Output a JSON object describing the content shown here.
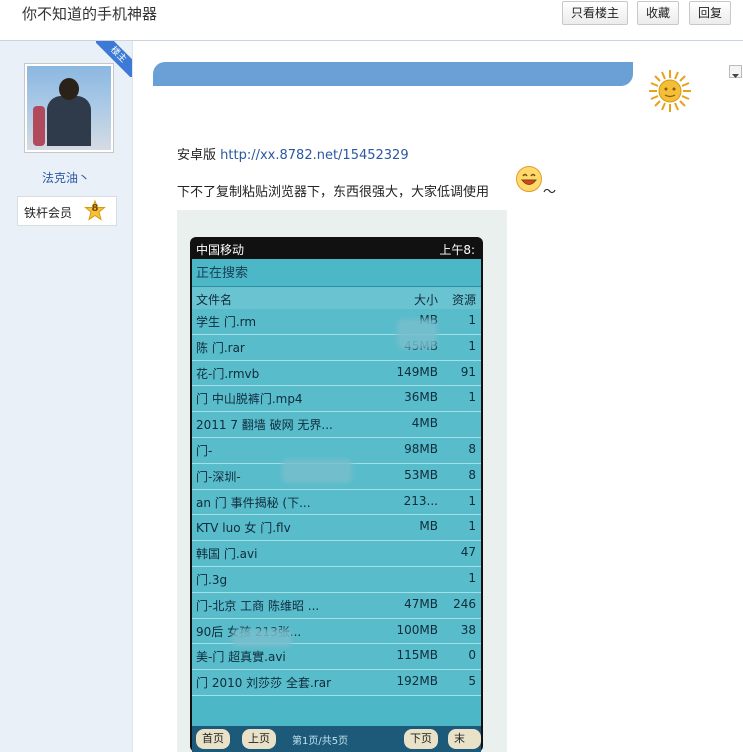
{
  "header": {
    "title": "你不知道的手机神器",
    "buttons": [
      "只看楼主",
      "收藏",
      "回复"
    ]
  },
  "author": {
    "corner_tag": "楼主",
    "username": "法克油丶",
    "rank_label": "铁杆会员",
    "level": "8"
  },
  "post": {
    "line1_prefix": "安卓版",
    "line1_link": "http://xx.8782.net/15452329",
    "line2": "下不了复制粘贴浏览器下，东西很强大，大家低调使用",
    "line2_suffix": "～"
  },
  "phone": {
    "carrier": "中国移动",
    "clock": "上午8:",
    "searching": "正在搜索",
    "columns": [
      "文件名",
      "大小",
      "资源"
    ],
    "rows": [
      {
        "name": "学生 门.rm",
        "size": "MB",
        "res": "1"
      },
      {
        "name": "陈 门.rar",
        "size": "45MB",
        "res": "1"
      },
      {
        "name": "花-门.rmvb",
        "size": "149MB",
        "res": "91"
      },
      {
        "name": "门 中山脱裤门.mp4",
        "size": "36MB",
        "res": "1"
      },
      {
        "name": "2011 7 翻墙 破网 无界...",
        "size": "4MB",
        "res": ""
      },
      {
        "name": "门-",
        "size": "98MB",
        "res": "8"
      },
      {
        "name": "门-深圳-",
        "size": "53MB",
        "res": "8"
      },
      {
        "name": "an 门 事件揭秘 (下...",
        "size": "213...",
        "res": "1"
      },
      {
        "name": "KTV luo 女 门.flv",
        "size": "MB",
        "res": "1"
      },
      {
        "name": "韩国 门.avi",
        "size": "",
        "res": "47"
      },
      {
        "name": "门.3g",
        "size": "",
        "res": "1"
      },
      {
        "name": "门-北京 工商 陈维昭 ...",
        "size": "47MB",
        "res": "246"
      },
      {
        "name": "90后 女孩 213张...",
        "size": "100MB",
        "res": "38"
      },
      {
        "name": "美-门 超真實.avi",
        "size": "115MB",
        "res": "0"
      },
      {
        "name": "门 2010 刘莎莎 全套.rar",
        "size": "192MB",
        "res": "5"
      }
    ],
    "pager": {
      "first": "首页",
      "prev": "上页",
      "info": "第1页/共5页",
      "next": "下页",
      "last": "末页"
    }
  }
}
